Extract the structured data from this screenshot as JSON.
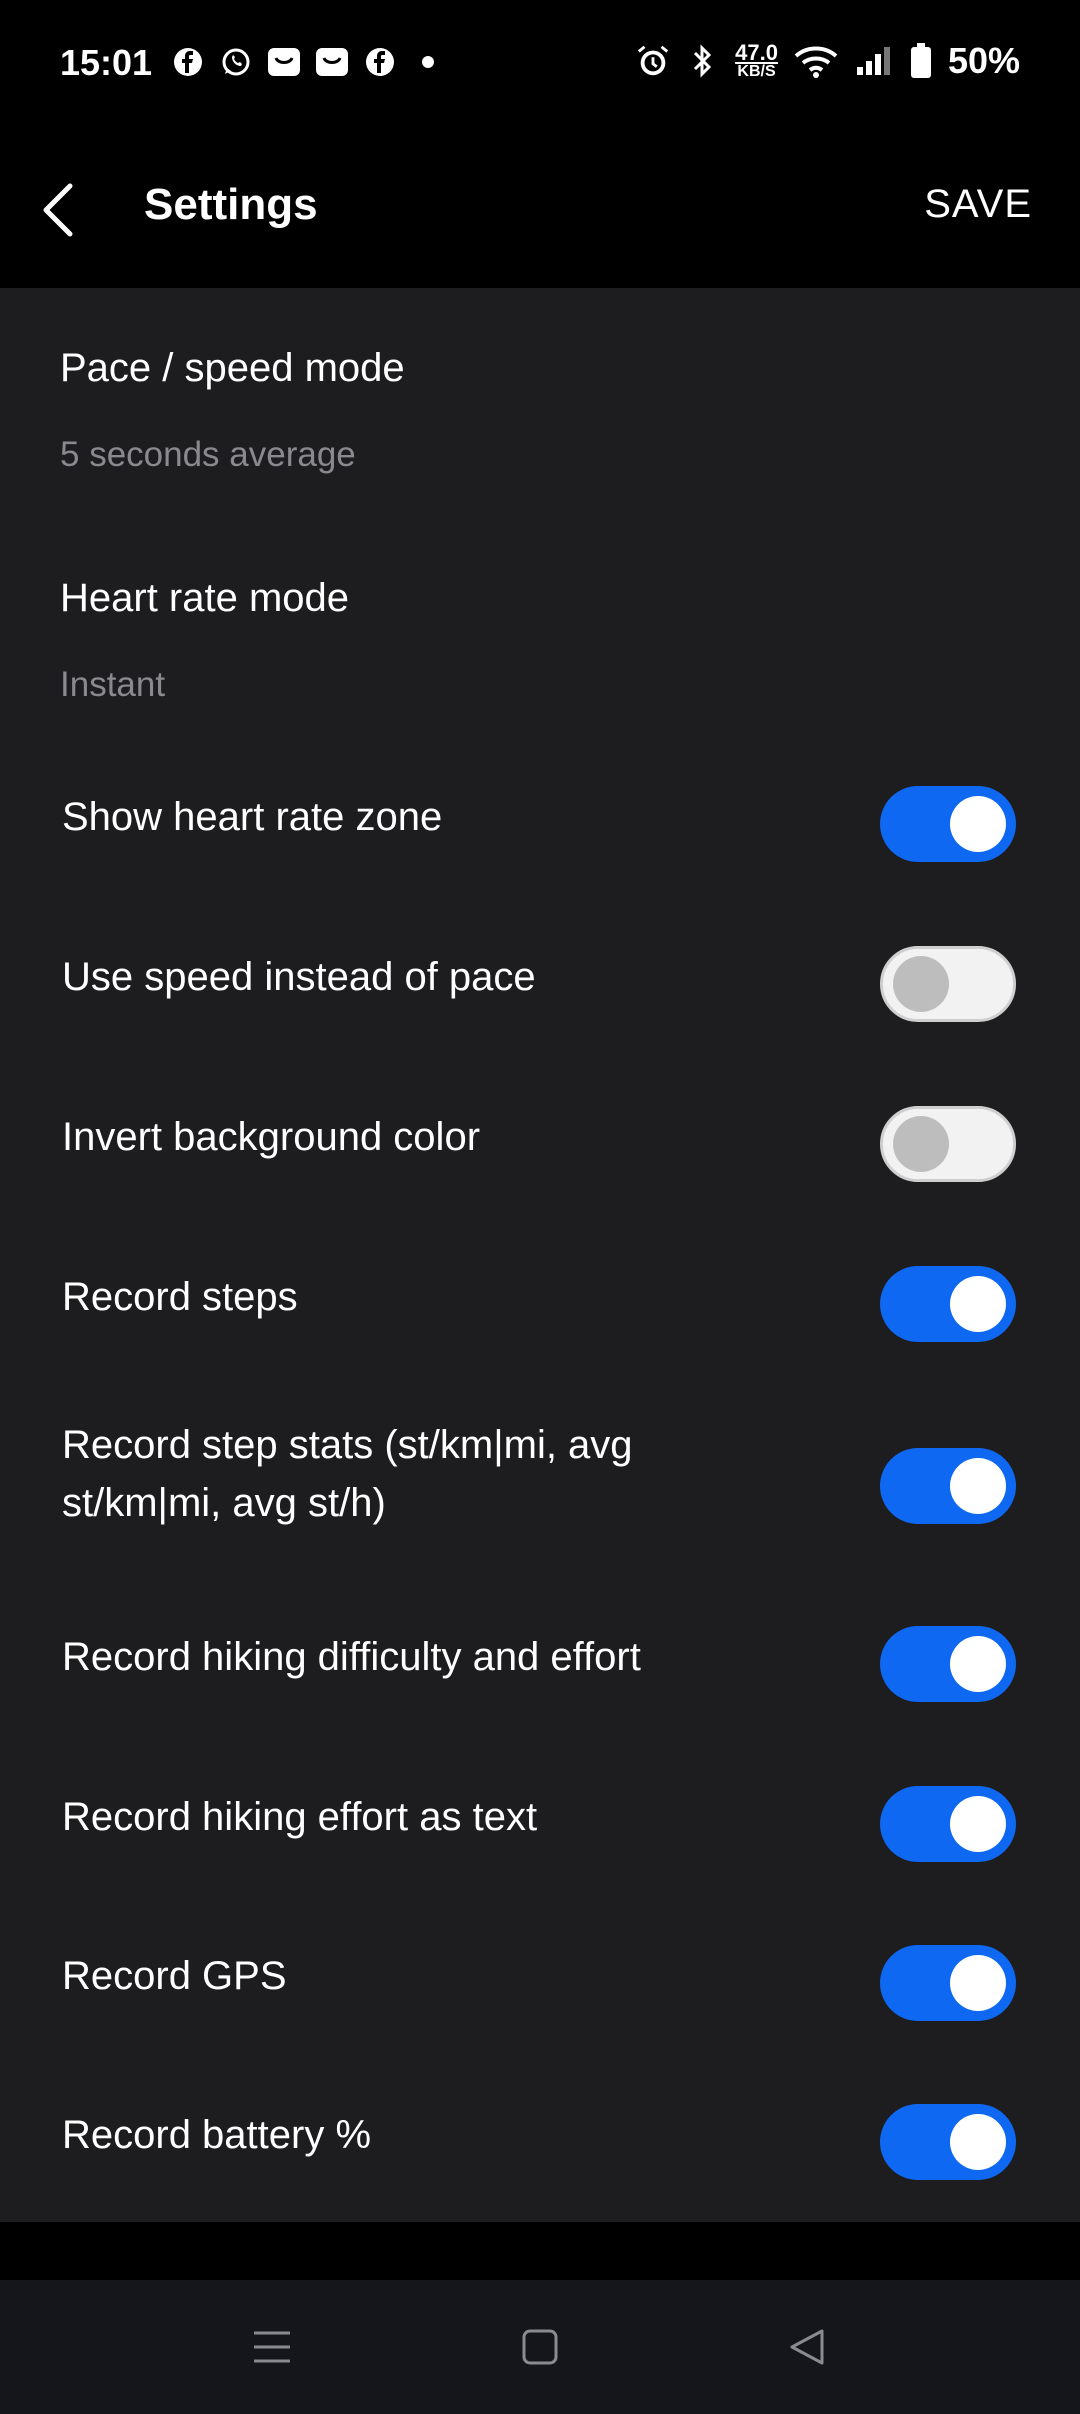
{
  "status_bar": {
    "time": "15:01",
    "left_icons": [
      "facebook-icon",
      "whatsapp-icon",
      "app-icon",
      "app-icon",
      "facebook-icon",
      "dot-icon"
    ],
    "network_speed_value": "47.0",
    "network_speed_unit": "KB/S",
    "battery_percent": "50%"
  },
  "app_bar": {
    "title": "Settings",
    "save_label": "SAVE"
  },
  "prefs": [
    {
      "title": "Pace / speed mode",
      "summary": "5 seconds average"
    },
    {
      "title": "Heart rate mode",
      "summary": "Instant"
    }
  ],
  "switches": [
    {
      "label": "Show heart rate zone",
      "on": true
    },
    {
      "label": "Use speed instead of pace",
      "on": false
    },
    {
      "label": "Invert background color",
      "on": false
    },
    {
      "label": "Record steps",
      "on": true
    },
    {
      "label": "Record step stats (st/km|mi, avg st/km|mi, avg st/h)",
      "on": true
    },
    {
      "label": "Record hiking difficulty and effort",
      "on": true
    },
    {
      "label": "Record hiking effort as text",
      "on": true
    },
    {
      "label": "Record GPS",
      "on": true
    },
    {
      "label": "Record battery %",
      "on": true
    }
  ],
  "colors": {
    "accent": "#0e68f2",
    "background": "#1d1d1f"
  }
}
